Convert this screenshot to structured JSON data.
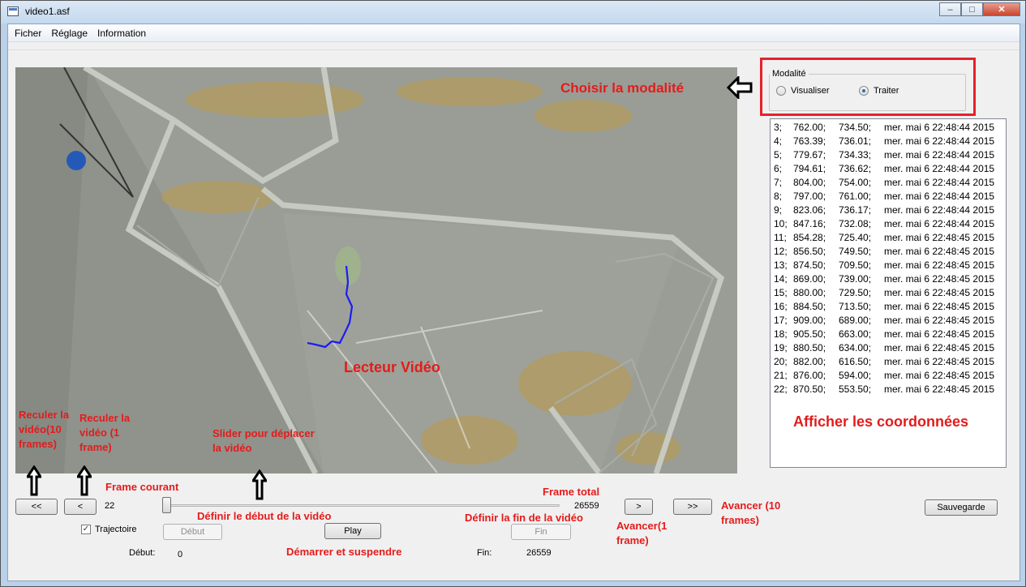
{
  "window": {
    "title": "video1.asf",
    "controls": [
      "minimize",
      "maximize",
      "close"
    ]
  },
  "menu": [
    "Ficher",
    "Réglage",
    "Information"
  ],
  "video": {
    "overlay_label": "Lecteur Vidéo"
  },
  "modalite": {
    "group_title": "Modalité",
    "options": [
      {
        "label": "Visualiser",
        "checked": false
      },
      {
        "label": "Traiter",
        "checked": true
      }
    ],
    "annotation": "Choisir la modalité"
  },
  "coordinates": [
    [
      "3;",
      "762.00;",
      "734.50;",
      "mer. mai 6 22:48:44 2015"
    ],
    [
      "4;",
      "763.39;",
      "736.01;",
      "mer. mai 6 22:48:44 2015"
    ],
    [
      "5;",
      "779.67;",
      "734.33;",
      "mer. mai 6 22:48:44 2015"
    ],
    [
      "6;",
      "794.61;",
      "736.62;",
      "mer. mai 6 22:48:44 2015"
    ],
    [
      "7;",
      "804.00;",
      "754.00;",
      "mer. mai 6 22:48:44 2015"
    ],
    [
      "8;",
      "797.00;",
      "761.00;",
      "mer. mai 6 22:48:44 2015"
    ],
    [
      "9;",
      "823.06;",
      "736.17;",
      "mer. mai 6 22:48:44 2015"
    ],
    [
      "10;",
      "847.16;",
      "732.08;",
      "mer. mai 6 22:48:44 2015"
    ],
    [
      "11;",
      "854.28;",
      "725.40;",
      "mer. mai 6 22:48:45 2015"
    ],
    [
      "12;",
      "856.50;",
      "749.50;",
      "mer. mai 6 22:48:45 2015"
    ],
    [
      "13;",
      "874.50;",
      "709.50;",
      "mer. mai 6 22:48:45 2015"
    ],
    [
      "14;",
      "869.00;",
      "739.00;",
      "mer. mai 6 22:48:45 2015"
    ],
    [
      "15;",
      "880.00;",
      "729.50;",
      "mer. mai 6 22:48:45 2015"
    ],
    [
      "16;",
      "884.50;",
      "713.50;",
      "mer. mai 6 22:48:45 2015"
    ],
    [
      "17;",
      "909.00;",
      "689.00;",
      "mer. mai 6 22:48:45 2015"
    ],
    [
      "18;",
      "905.50;",
      "663.00;",
      "mer. mai 6 22:48:45 2015"
    ],
    [
      "19;",
      "880.50;",
      "634.00;",
      "mer. mai 6 22:48:45 2015"
    ],
    [
      "20;",
      "882.00;",
      "616.50;",
      "mer. mai 6 22:48:45 2015"
    ],
    [
      "21;",
      "876.00;",
      "594.00;",
      "mer. mai 6 22:48:45 2015"
    ],
    [
      "22;",
      "870.50;",
      "553.50;",
      "mer. mai 6 22:48:45 2015"
    ]
  ],
  "coordinates_annotation": "Afficher les coordonnées",
  "controls": {
    "back10_label": "<<",
    "back1_label": "<",
    "current_frame": "22",
    "total_frames": "26559",
    "forward1_label": ">",
    "forward10_label": ">>",
    "save_label": "Sauvegarde",
    "trajectory_label": "Trajectoire",
    "trajectory_checked": true,
    "debut_button": "Début",
    "play_button": "Play",
    "fin_button": "Fin",
    "debut_label": "Début:",
    "debut_value": "0",
    "fin_label": "Fin:",
    "fin_value": "26559",
    "slider_position": 0
  },
  "annotations": {
    "back10": "Reculer la vidéo(10 frames)",
    "back1": "Reculer la vidéo (1 frame)",
    "slider": "Slider pour déplacer la vidéo",
    "current_frame": "Frame courant",
    "total_frame": "Frame total",
    "set_start": "Définir le début de la vidéo",
    "set_end": "Définir la fin de la vidéo",
    "play": "Démarrer et suspendre",
    "forward1": "Avancer(1 frame)",
    "forward10": "Avancer (10 frames)"
  }
}
